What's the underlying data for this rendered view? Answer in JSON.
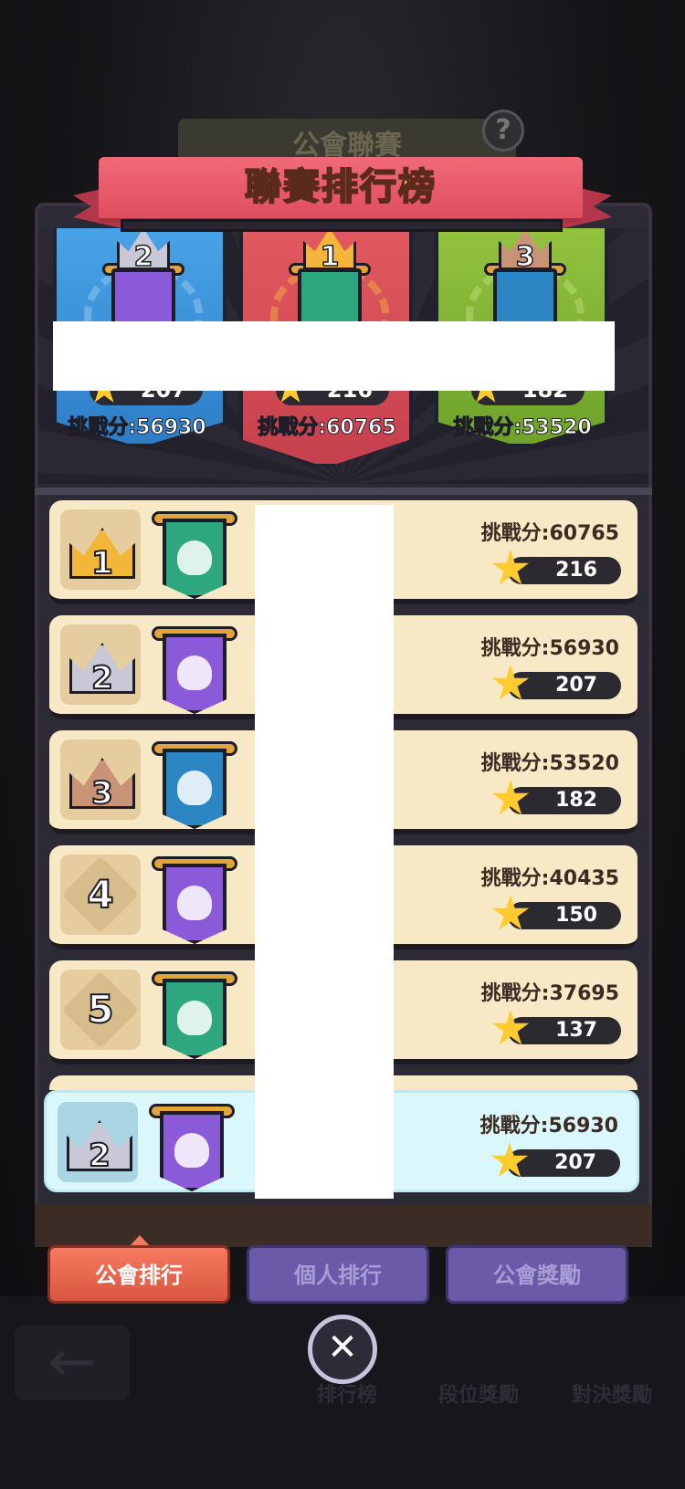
{
  "background": {
    "header_title": "公會聯賽",
    "help_icon": "question-icon"
  },
  "title": "聯賽排行榜",
  "podium": [
    {
      "rank": "2",
      "stars": "207",
      "score": "挑戰分:56930",
      "banner_color": "#2d7ec7",
      "flag_color": "#8a5ad8",
      "wreath_color": "#8ec6ef",
      "crown_color": "#c9c8d6"
    },
    {
      "rank": "1",
      "stars": "216",
      "score": "挑戰分:60765",
      "banner_color": "#c6404d",
      "flag_color": "#2ea77e",
      "wreath_color": "#f2a640",
      "crown_color": "#f3b63a"
    },
    {
      "rank": "3",
      "stars": "182",
      "score": "挑戰分:53520",
      "banner_color": "#6ea22b",
      "flag_color": "#2d86c4",
      "wreath_color": "#b7dc74",
      "crown_color": "#c99378"
    }
  ],
  "list": [
    {
      "rank": "1",
      "score": "挑戰分:60765",
      "stars": "216",
      "crown_color": "#f3b63a",
      "flag_color": "#2ea77e"
    },
    {
      "rank": "2",
      "score": "挑戰分:56930",
      "stars": "207",
      "crown_color": "#c9c8d6",
      "flag_color": "#8a5ad8"
    },
    {
      "rank": "3",
      "score": "挑戰分:53520",
      "stars": "182",
      "crown_color": "#c99378",
      "flag_color": "#2d86c4"
    },
    {
      "rank": "4",
      "score": "挑戰分:40435",
      "stars": "150",
      "crown_color": "",
      "flag_color": "#8a5ad8"
    },
    {
      "rank": "5",
      "score": "挑戰分:37695",
      "stars": "137",
      "crown_color": "",
      "flag_color": "#2ea77e"
    }
  ],
  "my_guild": {
    "rank": "2",
    "score": "挑戰分:56930",
    "stars": "207",
    "crown_color": "#c9c8d6",
    "flag_color": "#8a5ad8"
  },
  "tabs": [
    {
      "label": "公會排行",
      "active": true
    },
    {
      "label": "個人排行",
      "active": false
    },
    {
      "label": "公會獎勵",
      "active": false
    }
  ],
  "close_icon": "close-icon",
  "bottom_nav": {
    "back_icon": "back-arrow-icon",
    "items": [
      "排行榜",
      "段位獎勵",
      "對決獎勵"
    ]
  }
}
